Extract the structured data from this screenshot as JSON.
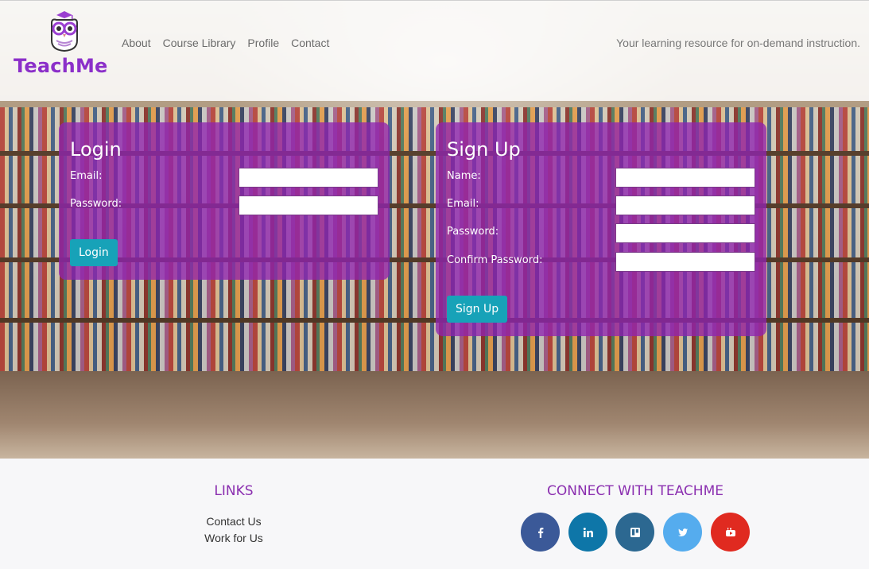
{
  "header": {
    "brand": "TeachMe",
    "nav": [
      "About",
      "Course Library",
      "Profile",
      "Contact"
    ],
    "tagline": "Your learning resource for on-demand instruction."
  },
  "login": {
    "title": "Login",
    "fields": [
      {
        "label": "Email:",
        "value": ""
      },
      {
        "label": "Password:",
        "value": ""
      }
    ],
    "button": "Login"
  },
  "signup": {
    "title": "Sign Up",
    "fields": [
      {
        "label": "Name:",
        "value": ""
      },
      {
        "label": "Email:",
        "value": ""
      },
      {
        "label": "Password:",
        "value": ""
      },
      {
        "label": "Confirm Password:",
        "value": ""
      }
    ],
    "button": "Sign Up"
  },
  "footer": {
    "links_title": "LINKS",
    "links": [
      "Contact Us",
      "Work for Us"
    ],
    "connect_title": "CONNECT WITH TEACHME",
    "social": [
      {
        "icon": "facebook-icon",
        "color": "#3b5998"
      },
      {
        "icon": "linkedin-icon",
        "color": "#0e76a8"
      },
      {
        "icon": "trello-icon",
        "color": "#2c6891"
      },
      {
        "icon": "twitter-icon",
        "color": "#55acee"
      },
      {
        "icon": "youtube-icon",
        "color": "#e02a20"
      }
    ]
  },
  "colors": {
    "accent": "#8b2fc9",
    "panel": "#8f24af",
    "button": "#17a2b8"
  }
}
